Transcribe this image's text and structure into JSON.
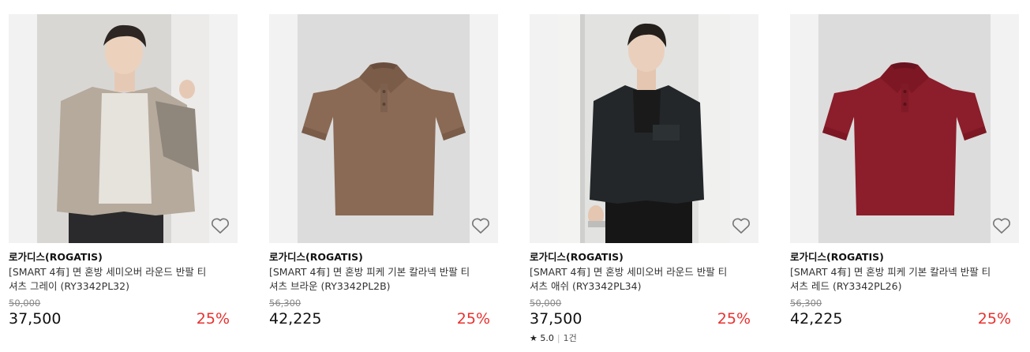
{
  "products": [
    {
      "brand": "로가디스(ROGATIS)",
      "title": "[SMART 4有] 면 혼방 세미오버 라운드 반팔 티셔츠 그레이 (RY3342PL32)",
      "original_price": "50,000",
      "price": "37,500",
      "discount": "25%",
      "image": "model-beige-jacket-photo"
    },
    {
      "brand": "로가디스(ROGATIS)",
      "title": "[SMART 4有] 면 혼방 피케 기본 칼라넥 반팔 티셔츠 브라운 (RY3342PL2B)",
      "original_price": "56,300",
      "price": "42,225",
      "discount": "25%",
      "image": "brown-polo-photo"
    },
    {
      "brand": "로가디스(ROGATIS)",
      "title": "[SMART 4有] 면 혼방 세미오버 라운드 반팔 티셔츠 애쉬 (RY3342PL34)",
      "original_price": "50,000",
      "price": "37,500",
      "discount": "25%",
      "image": "model-black-jacket-photo",
      "rating": "★ 5.0",
      "review_count": "1건"
    },
    {
      "brand": "로가디스(ROGATIS)",
      "title": "[SMART 4有] 면 혼방 피케 기본 칼라넥 반팔 티셔츠 레드 (RY3342PL26)",
      "original_price": "56,300",
      "price": "42,225",
      "discount": "25%",
      "image": "red-polo-photo"
    }
  ],
  "colors": {
    "discount": "#e8312f",
    "thumb_bg": "#f2f2f2"
  },
  "icons": {
    "wishlist": "heart-outline-icon"
  }
}
